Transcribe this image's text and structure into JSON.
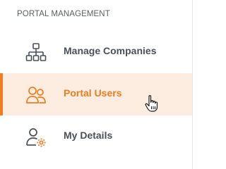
{
  "sidebar": {
    "section_heading": "PORTAL MANAGEMENT",
    "items": [
      {
        "label": "Manage Companies",
        "icon": "sitemap-icon",
        "active": false
      },
      {
        "label": "Portal Users",
        "icon": "users-icon",
        "active": true
      },
      {
        "label": "My Details",
        "icon": "user-settings-icon",
        "active": false
      }
    ]
  },
  "colors": {
    "accent": "#ed7d1f",
    "active_background": "#fdece0",
    "icon_default": "#4a5058",
    "text_default": "#4a5058"
  },
  "cursor": {
    "icon": "hand-pointer-icon"
  }
}
